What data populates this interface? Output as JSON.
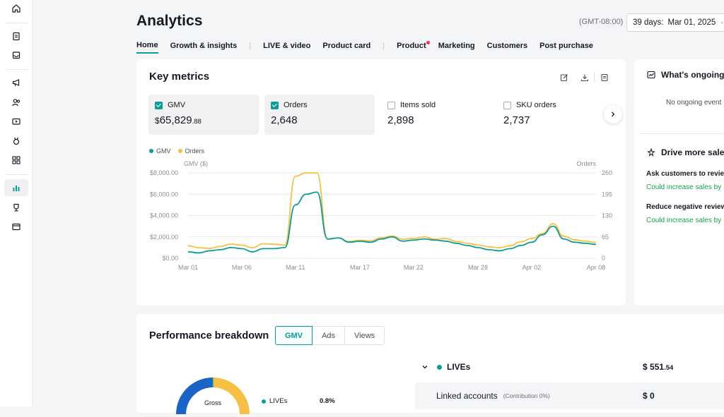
{
  "rail": {
    "icons": [
      "home-icon",
      "clipboard-icon",
      "inbox-icon",
      "megaphone-icon",
      "users-icon",
      "video-icon",
      "medal-icon",
      "apps-icon",
      "bar-chart-icon",
      "trophy-icon",
      "wallet-icon"
    ]
  },
  "header": {
    "title": "Analytics",
    "timezone": "(GMT-08:00)",
    "date_range_label": "39 days:",
    "date_range_value": "Mar 01, 2025",
    "date_range_dash": "-"
  },
  "tabs": [
    {
      "label": "Home",
      "active": true
    },
    {
      "label": "Growth & insights"
    },
    {
      "sep": "|"
    },
    {
      "label": "LIVE & video"
    },
    {
      "label": "Product card"
    },
    {
      "sep": "|"
    },
    {
      "label": "Product",
      "dot": true
    },
    {
      "label": "Marketing"
    },
    {
      "label": "Customers"
    },
    {
      "label": "Post purchase"
    }
  ],
  "key_metrics": {
    "title": "Key metrics",
    "metrics": [
      {
        "label": "GMV",
        "checked": true,
        "currency": "$",
        "value": "65,829",
        "decimal": ".88"
      },
      {
        "label": "Orders",
        "checked": true,
        "value": "2,648"
      },
      {
        "label": "Items sold",
        "checked": false,
        "value": "2,898"
      },
      {
        "label": "SKU orders",
        "checked": false,
        "value": "2,737"
      }
    ]
  },
  "chart_data": {
    "type": "line",
    "x": [
      "Mar 01",
      "Mar 02",
      "Mar 03",
      "Mar 04",
      "Mar 05",
      "Mar 06",
      "Mar 07",
      "Mar 08",
      "Mar 09",
      "Mar 10",
      "Mar 11",
      "Mar 12",
      "Mar 13",
      "Mar 14",
      "Mar 15",
      "Mar 16",
      "Mar 17",
      "Mar 18",
      "Mar 19",
      "Mar 20",
      "Mar 21",
      "Mar 22",
      "Mar 23",
      "Mar 24",
      "Mar 25",
      "Mar 26",
      "Mar 27",
      "Mar 28",
      "Mar 29",
      "Mar 30",
      "Mar 31",
      "Apr 01",
      "Apr 02",
      "Apr 03",
      "Apr 04",
      "Apr 05",
      "Apr 06",
      "Apr 07",
      "Apr 08"
    ],
    "x_tick_labels": [
      "Mar 01",
      "Mar 06",
      "Mar 11",
      "Mar 17",
      "Mar 22",
      "Mar 28",
      "Apr 02",
      "Apr 08"
    ],
    "series": [
      {
        "name": "GMV",
        "axis": "left",
        "color": "#0b9d96",
        "values": [
          600,
          500,
          700,
          800,
          1000,
          900,
          600,
          900,
          900,
          1000,
          5000,
          6000,
          6200,
          1800,
          1900,
          1500,
          1600,
          1500,
          1800,
          2000,
          1600,
          1700,
          1800,
          1700,
          1600,
          1400,
          1200,
          1000,
          800,
          700,
          900,
          1200,
          1500,
          2200,
          3000,
          1800,
          1500,
          1400,
          1300
        ]
      },
      {
        "name": "Orders",
        "axis": "right",
        "color": "#f5c044",
        "values": [
          38,
          32,
          30,
          36,
          43,
          40,
          32,
          44,
          43,
          40,
          250,
          260,
          260,
          58,
          62,
          51,
          55,
          53,
          62,
          68,
          58,
          60,
          65,
          58,
          60,
          51,
          46,
          40,
          35,
          32,
          38,
          50,
          60,
          75,
          105,
          67,
          56,
          52,
          48
        ]
      }
    ],
    "left_axis": {
      "title": "GMV ($)",
      "ticks": [
        "$8,000.00",
        "$6,000.00",
        "$4,000.00",
        "$2,000.00",
        "$0.00"
      ],
      "range": [
        0,
        8000
      ]
    },
    "right_axis": {
      "title": "Orders",
      "ticks": [
        "260",
        "195",
        "130",
        "65",
        "0"
      ],
      "range": [
        0,
        260
      ]
    },
    "legend": [
      "GMV",
      "Orders"
    ],
    "grid": true
  },
  "side": {
    "ongoing_title": "What's ongoing",
    "ongoing_empty": "No ongoing event",
    "drive_title": "Drive more sales",
    "tip1_title": "Ask customers to revie",
    "tip1_link": "Could increase sales by",
    "tip2_title": "Reduce negative review",
    "tip2_link": "Could increase sales by"
  },
  "performance": {
    "title": "Performance breakdown",
    "tabs": [
      "GMV",
      "Ads",
      "Views"
    ],
    "active_tab": "GMV",
    "donut_center": "Gross",
    "donut_legend_label": "LIVEs",
    "donut_legend_pct": "0.8%",
    "rows": [
      {
        "label": "LIVEs",
        "currency": "$",
        "value": "551",
        "decimal": ".54"
      },
      {
        "label": "Linked accounts",
        "note": "(Contribution 0%)",
        "currency": "$",
        "value": "0"
      }
    ]
  },
  "colors": {
    "accent": "#0b9d96",
    "orders": "#f5c044",
    "link": "#15a346",
    "donut_blue": "#1a63c7",
    "donut_yellow": "#f5c044"
  }
}
